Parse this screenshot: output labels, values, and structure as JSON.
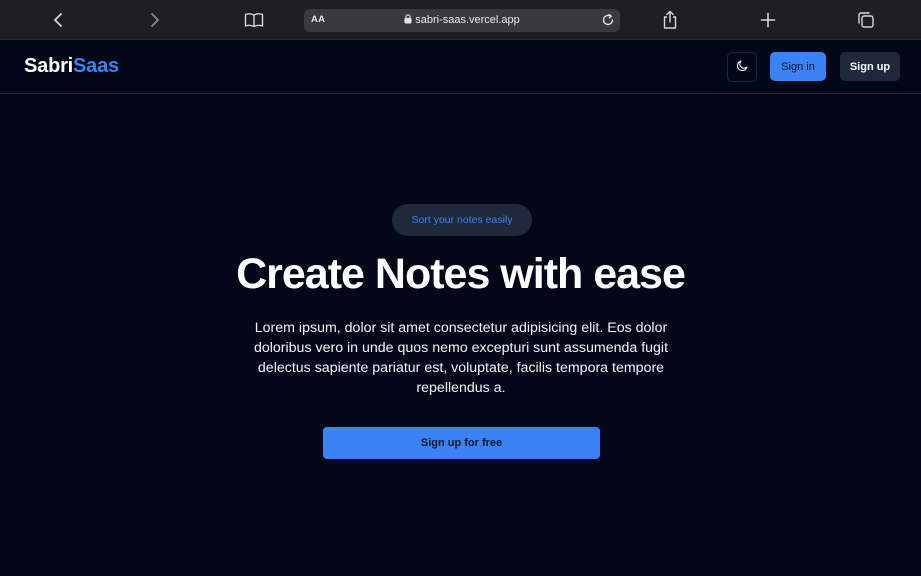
{
  "browser": {
    "text_size_label": "AA",
    "url": "sabri-saas.vercel.app",
    "icons": [
      "back-icon",
      "forward-icon",
      "bookmarks-icon",
      "lock-icon",
      "reload-icon",
      "share-icon",
      "new-tab-icon",
      "tabs-icon"
    ]
  },
  "header": {
    "logo_part1": "Sabri",
    "logo_part2": "Saas",
    "sign_in_label": "Sign in",
    "sign_up_label": "Sign up",
    "theme_icon": "moon-icon"
  },
  "hero": {
    "badge": "Sort your notes easily",
    "title": "Create Notes with ease",
    "description": "Lorem ipsum, dolor sit amet consectetur adipisicing elit. Eos dolor doloribus vero in unde quos nemo excepturi sunt assumenda fugit delectus sapiente pariatur est, voluptate, facilis tempora tempore repellendus a.",
    "cta_label": "Sign up for free"
  },
  "colors": {
    "background": "#020817",
    "accent": "#3b82f6",
    "muted": "#1e293b"
  }
}
